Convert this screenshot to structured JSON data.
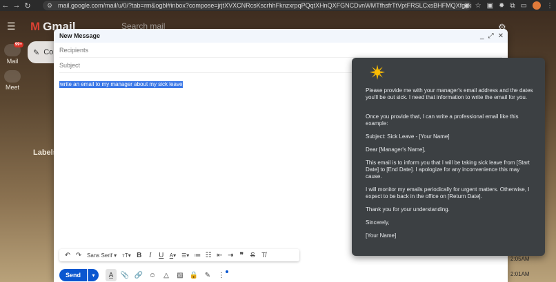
{
  "browser": {
    "url": "mail.google.com/mail/u/0/?tab=rm&ogbl#inbox?compose=jrjtXVXCNRcsKscrhhFknzxrpqPQqtXHnQXFGNCDvnWMTfhsfrTtVptFRSLCxsBHFMQXfgzk"
  },
  "gmail": {
    "logo_text": "Gmail",
    "search_placeholder": "Search mail",
    "rail": {
      "mail_label": "Mail",
      "mail_badge": "99+",
      "meet_label": "Meet"
    },
    "compose_button_label": "Co",
    "labels_heading": "Labels",
    "times": [
      "2:05AM",
      "2:01AM"
    ]
  },
  "compose": {
    "title": "New Message",
    "recipients_placeholder": "Recipients",
    "subject_placeholder": "Subject",
    "body_text": "write an email to my manager about my sick leave",
    "format_bar": {
      "font_name": "Sans Serif"
    },
    "send_label": "Send"
  },
  "assistant": {
    "paragraphs": [
      "Please provide me with your manager's email address and the dates you'll be out sick. I need that information to write the email for you.",
      "Once you provide that, I can write a professional email like this example:",
      "Subject: Sick Leave - [Your Name]",
      "Dear [Manager's Name],",
      "This email is to inform you that I will be taking sick leave from [Start Date] to [End Date]. I apologize for any inconvenience this may cause.",
      "I will monitor my emails periodically for urgent matters. Otherwise, I expect to be back in the office on [Return Date].",
      "Thank you for your understanding.",
      "Sincerely,",
      "[Your Name]"
    ],
    "icon": "sparkle-star-icon"
  },
  "colors": {
    "send_blue": "#0b57d0",
    "selection_blue": "#3b78e7",
    "assistant_bg": "#3c4043",
    "badge_red": "#d93025"
  }
}
